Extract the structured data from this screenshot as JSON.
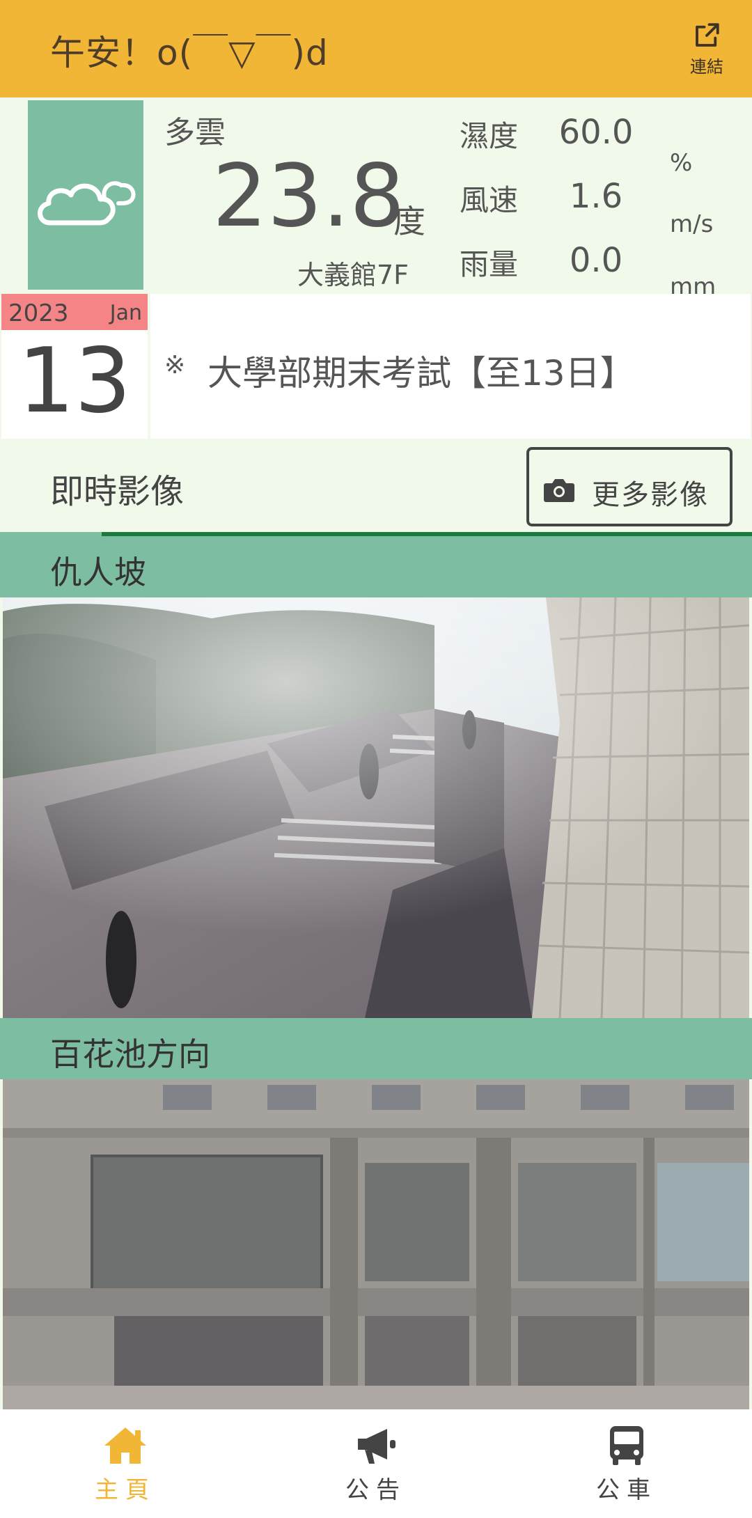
{
  "header": {
    "greeting": "午安！o(￣▽￣)d",
    "link_label": "連結"
  },
  "weather": {
    "condition": "多雲",
    "temperature": "23.8",
    "temp_unit": "度",
    "station": "大義館7F",
    "humidity": {
      "label": "濕度",
      "value": "60.0",
      "unit": "%"
    },
    "wind": {
      "label": "風速",
      "value": "1.6",
      "unit": "m/s"
    },
    "rain": {
      "label": "雨量",
      "value": "0.0",
      "unit": "mm"
    },
    "icon": "cloud-icon"
  },
  "date": {
    "year": "2023",
    "month": "Jan",
    "day": "13"
  },
  "notice": {
    "mark": "※",
    "text": "大學部期末考試【至13日】"
  },
  "live": {
    "title": "即時影像",
    "more_label": "更多影像"
  },
  "cameras": [
    {
      "title": "仇人坡"
    },
    {
      "title": "百花池方向"
    }
  ],
  "nav": {
    "items": [
      {
        "label": "主頁",
        "icon": "home-icon",
        "active": true
      },
      {
        "label": "公告",
        "icon": "megaphone-icon",
        "active": false
      },
      {
        "label": "公車",
        "icon": "bus-icon",
        "active": false
      }
    ]
  },
  "colors": {
    "header_bg": "#f2b636",
    "panel_bg": "#f1faea",
    "accent_green": "#7dbea3",
    "date_strip": "#f48485",
    "nav_active": "#f2b636",
    "nav_inactive": "#444444"
  }
}
